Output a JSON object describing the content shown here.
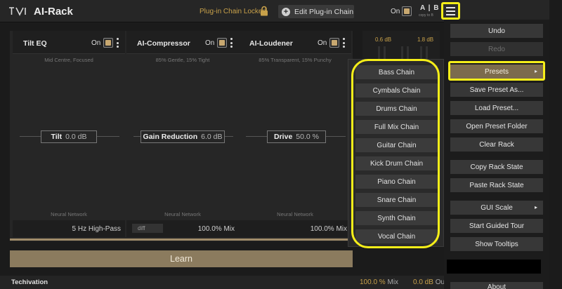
{
  "header": {
    "title": "AI-Rack",
    "chain_locked": "Plug-in Chain Locked",
    "edit_chain": "Edit Plug-in Chain",
    "on_label": "On",
    "ab_label": "A | B",
    "ab_sub": "copy to B"
  },
  "slots": [
    {
      "title": "Tilt EQ",
      "on_label": "On",
      "subtitle": "Mid Centre, Focused",
      "param_label": "Tilt",
      "param_value": "0.0 dB",
      "nn_label": "Neural Network",
      "footer": "5 Hz  High-Pass"
    },
    {
      "title": "AI-Compressor",
      "on_label": "On",
      "subtitle": "85% Gentle, 15% Tight",
      "param_label": "Gain Reduction",
      "param_value": "6.0 dB",
      "nn_label": "Neural Network",
      "diff": "diff",
      "footer": "100.0%  Mix"
    },
    {
      "title": "AI-Loudener",
      "on_label": "On",
      "subtitle": "85% Transparent, 15% Punchy",
      "param_label": "Drive",
      "param_value": "50.0 %",
      "nn_label": "Neural Network",
      "footer": "100.0%  Mix"
    }
  ],
  "learn_label": "Learn",
  "meters": {
    "left_value": "0.6 dB",
    "right_value": "1.8 dB"
  },
  "bottom": {
    "brand": "Techivation",
    "mix_value": "100.0 %",
    "mix_unit": "Mix",
    "out_value": "0.0 dB",
    "out_unit": "Out"
  },
  "presets_submenu": [
    "Bass Chain",
    "Cymbals Chain",
    "Drums Chain",
    "Full Mix Chain",
    "Guitar Chain",
    "Kick Drum Chain",
    "Piano Chain",
    "Snare Chain",
    "Synth Chain",
    "Vocal Chain"
  ],
  "main_menu": {
    "undo": "Undo",
    "redo": "Redo",
    "presets": "Presets",
    "save_preset": "Save Preset As...",
    "load_preset": "Load Preset...",
    "open_folder": "Open Preset Folder",
    "clear_rack": "Clear Rack",
    "copy_state": "Copy Rack State",
    "paste_state": "Paste Rack State",
    "gui_scale": "GUI Scale",
    "guided_tour": "Start Guided Tour",
    "show_tooltips": "Show Tooltips",
    "about": "About"
  },
  "colors": {
    "accent_gold": "#c8a14a",
    "highlight_yellow": "#f5ee19",
    "learn_bg": "#8b7b5e"
  }
}
